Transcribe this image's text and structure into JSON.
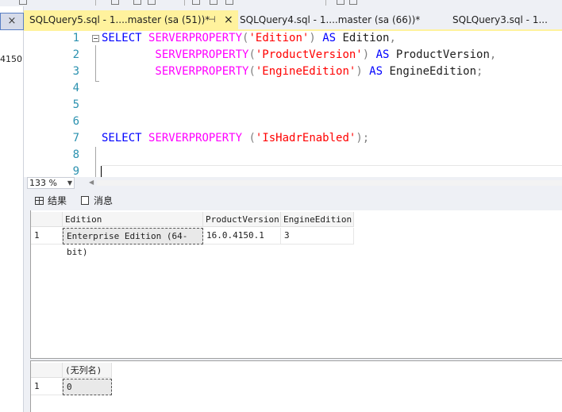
{
  "tabs": [
    {
      "label": "SQLQuery5.sql - 1....master (sa (51))*",
      "active": true,
      "pin": "⊣",
      "close": "×"
    },
    {
      "label": "SQLQuery4.sql - 1....master (sa (66))*",
      "active": false
    },
    {
      "label": "SQLQuery3.sql - 1...",
      "active": false
    }
  ],
  "left_panel": {
    "close": "×",
    "text": "4150"
  },
  "editor": {
    "line_numbers": [
      "1",
      "2",
      "3",
      "4",
      "5",
      "6",
      "7",
      "8",
      "9"
    ],
    "lines": [
      [
        {
          "t": "SELECT ",
          "c": "kw"
        },
        {
          "t": "SERVERPROPERTY",
          "c": "fn"
        },
        {
          "t": "(",
          "c": "gray"
        },
        {
          "t": "'Edition'",
          "c": "str"
        },
        {
          "t": ")",
          "c": "gray"
        },
        {
          "t": " AS ",
          "c": "kw"
        },
        {
          "t": "Edition",
          "c": "plain"
        },
        {
          "t": ",",
          "c": "gray"
        }
      ],
      [
        {
          "t": "        SERVERPROPERTY",
          "c": "fn"
        },
        {
          "t": "(",
          "c": "gray"
        },
        {
          "t": "'ProductVersion'",
          "c": "str"
        },
        {
          "t": ")",
          "c": "gray"
        },
        {
          "t": " AS ",
          "c": "kw"
        },
        {
          "t": "ProductVersion",
          "c": "plain"
        },
        {
          "t": ",",
          "c": "gray"
        }
      ],
      [
        {
          "t": "        SERVERPROPERTY",
          "c": "fn"
        },
        {
          "t": "(",
          "c": "gray"
        },
        {
          "t": "'EngineEdition'",
          "c": "str"
        },
        {
          "t": ")",
          "c": "gray"
        },
        {
          "t": " AS ",
          "c": "kw"
        },
        {
          "t": "EngineEdition",
          "c": "plain"
        },
        {
          "t": ";",
          "c": "gray"
        }
      ],
      [],
      [],
      [],
      [
        {
          "t": "SELECT ",
          "c": "kw"
        },
        {
          "t": "SERVERPROPERTY ",
          "c": "fn"
        },
        {
          "t": "(",
          "c": "gray"
        },
        {
          "t": "'IsHadrEnabled'",
          "c": "str"
        },
        {
          "t": ");",
          "c": "gray"
        }
      ],
      [],
      []
    ]
  },
  "zoom": {
    "value": "133 %"
  },
  "results_tabs": {
    "results": "结果",
    "messages": "消息"
  },
  "grid1": {
    "columns": [
      "Edition",
      "ProductVersion",
      "EngineEdition"
    ],
    "rows": [
      {
        "row": "1",
        "cells": [
          "Enterprise Edition (64-bit)",
          "16.0.4150.1",
          "3"
        ]
      }
    ]
  },
  "grid2": {
    "columns": [
      "(无列名)"
    ],
    "rows": [
      {
        "row": "1",
        "cells": [
          "0"
        ]
      }
    ]
  },
  "colors": {
    "active_tab": "#fff29d",
    "keyword": "#0000ff",
    "function": "#ff00ff",
    "string": "#ff0000",
    "line_number": "#2b91af"
  }
}
